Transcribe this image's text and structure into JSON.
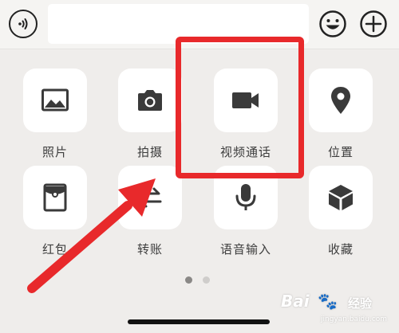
{
  "input_bar": {
    "text_value": "",
    "voice_icon": "voice-waves-icon",
    "emoji_icon": "smiley-icon",
    "plus_icon": "plus-circle-icon"
  },
  "panel": {
    "items": [
      {
        "label": "照片",
        "icon": "photo-icon"
      },
      {
        "label": "拍摄",
        "icon": "camera-icon"
      },
      {
        "label": "视频通话",
        "icon": "video-camera-icon"
      },
      {
        "label": "位置",
        "icon": "location-pin-icon"
      },
      {
        "label": "红包",
        "icon": "red-packet-icon"
      },
      {
        "label": "转账",
        "icon": "transfer-icon"
      },
      {
        "label": "语音输入",
        "icon": "microphone-icon"
      },
      {
        "label": "收藏",
        "icon": "favorites-cube-icon"
      }
    ],
    "page_indicator": {
      "pages": 2,
      "current": 1
    }
  },
  "annotation": {
    "highlight_target": "视频通话",
    "highlight_color": "#e8292b",
    "arrow_color": "#e8292b"
  },
  "watermark": {
    "logo_text": "Bai",
    "brand_text": "经验",
    "url": "jingyan.baidu.com"
  },
  "colors": {
    "background": "#efedeb",
    "tile": "#ffffff",
    "icon": "#3a3a3a"
  }
}
